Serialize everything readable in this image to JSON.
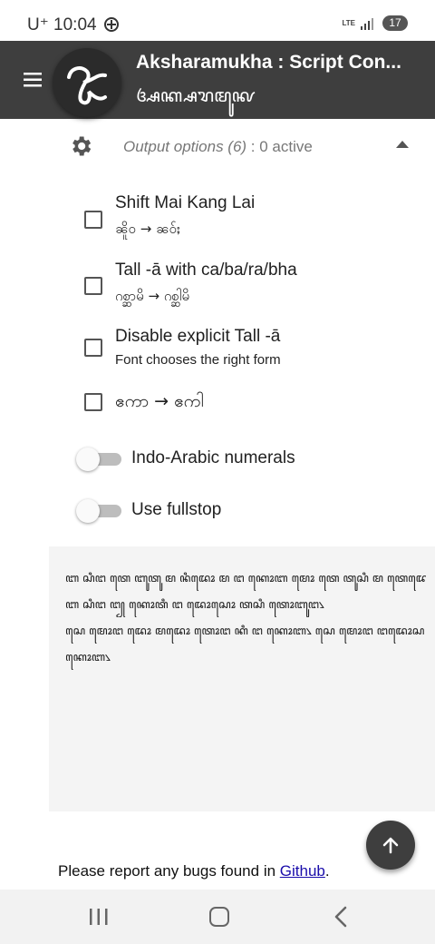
{
  "status_bar": {
    "carrier": "U⁺",
    "time": "10:04",
    "network": "LTE",
    "battery": "17"
  },
  "app_bar": {
    "title": "Aksharamukha : Script Con...",
    "subtitle": "ꦄꦏ꧀ꦱꦫꦩꦸꦑ"
  },
  "output_options": {
    "label": "Output options (6)",
    "active_text": " : 0 active"
  },
  "options": [
    {
      "title": "Shift Mai Kang Lai",
      "example": "ၼိူဝ → ၼဝ်ႈ",
      "checked": false
    },
    {
      "title": "Tall -ā with ca/ba/ra/bha",
      "example": "ဂစ္ဆာမိ → ဂစ္ဆါမိ",
      "checked": false
    },
    {
      "title": "Disable explicit Tall -ā",
      "example": "Font chooses the right form",
      "checked": false
    },
    {
      "title": "ဧကာ → ဧကါ",
      "example": "",
      "checked": false
    }
  ],
  "toggles": [
    {
      "label": "Indo-Arabic numerals",
      "on": false
    },
    {
      "label": "Use fullstop",
      "on": false
    }
  ],
  "output_text": [
    "ꦧ ꦱꦶꦔ ꦠꦺ ꦧꦸꦠꦸ ꦩ ꦤꦶꦢꦺꦴ ꦩ ꦔ ꦏꦺꦴꦧ ꦩꦺꦴ ꦠꦺ ꦠꦸꦱꦶ ꦩ ꦠꦺꦢꦺꦴ ꦠꦸꦱꦶꦔ꧀꧈",
    "ꦧ ꦱꦶꦔ ꦔ꧀ ꦏꦺꦴꦠꦶ ꦔ ꦢꦺꦴꦱꦺꦴ ꦠꦱꦶ ꦠꦺꦴꦧꦸꦔ꧈",
    "ꦱꦺ ꦩꦺꦴꦔ ꦢꦺꦴ ꦩꦢꦺꦴ ꦠꦺꦴꦔ ꦏꦶ ꦔ ꦏꦺꦴꦧ꧈ ꦱꦺ ꦩꦺꦴꦔ ꦔꦢꦺꦴꦱ ꦩꦔ ꦏꦶ ꦔ",
    "ꦏꦺꦴꦧ꧈"
  ],
  "footer": {
    "text": "Please report any bugs found in ",
    "link": "Github",
    "end": "."
  },
  "colors": {
    "app_bar": "#3e3e3e",
    "output_bg": "#f4f4f4",
    "link": "#1a0dab"
  }
}
